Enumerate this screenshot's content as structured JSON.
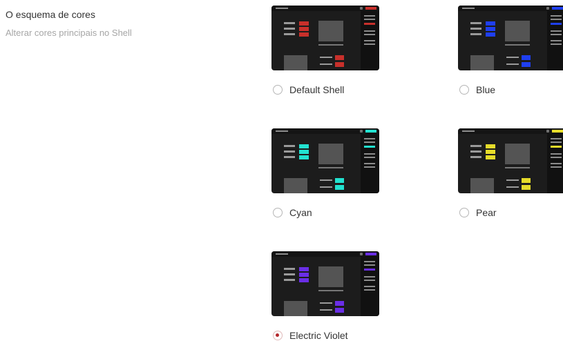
{
  "header": {
    "title": "O esquema de cores",
    "subtitle": "Alterar cores principais no Shell"
  },
  "schemes": [
    {
      "label": "Default Shell",
      "accent": "#c8302b",
      "selected": false
    },
    {
      "label": "Blue",
      "accent": "#1f3ff0",
      "selected": false
    },
    {
      "label": "Cyan",
      "accent": "#22e2d0",
      "selected": false
    },
    {
      "label": "Pear",
      "accent": "#e6dc2a",
      "selected": false
    },
    {
      "label": "Electric Violet",
      "accent": "#6a2ee6",
      "selected": true
    }
  ],
  "colors": {
    "radio_selected": "#b3262b",
    "preview_background": "#1c1c1c"
  }
}
